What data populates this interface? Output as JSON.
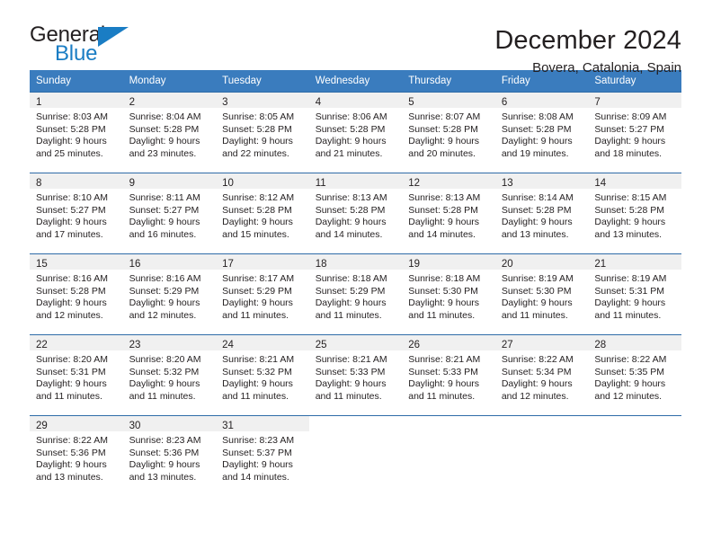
{
  "brand": {
    "name_dark": "General",
    "name_light": "Blue",
    "triangle_icon": "brand-triangle-icon",
    "accent_color": "#1a7dc4"
  },
  "header": {
    "title": "December 2024",
    "subtitle": "Bovera, Catalonia, Spain"
  },
  "colors": {
    "header_blue": "#3a7cbe",
    "row_divider_blue": "#2f6ca8",
    "daynum_band": "#f0f0f0",
    "text": "#231f20"
  },
  "weekday_headers": [
    "Sunday",
    "Monday",
    "Tuesday",
    "Wednesday",
    "Thursday",
    "Friday",
    "Saturday"
  ],
  "weeks": [
    [
      {
        "day": "1",
        "sunrise": "Sunrise: 8:03 AM",
        "sunset": "Sunset: 5:28 PM",
        "daylight1": "Daylight: 9 hours",
        "daylight2": "and 25 minutes."
      },
      {
        "day": "2",
        "sunrise": "Sunrise: 8:04 AM",
        "sunset": "Sunset: 5:28 PM",
        "daylight1": "Daylight: 9 hours",
        "daylight2": "and 23 minutes."
      },
      {
        "day": "3",
        "sunrise": "Sunrise: 8:05 AM",
        "sunset": "Sunset: 5:28 PM",
        "daylight1": "Daylight: 9 hours",
        "daylight2": "and 22 minutes."
      },
      {
        "day": "4",
        "sunrise": "Sunrise: 8:06 AM",
        "sunset": "Sunset: 5:28 PM",
        "daylight1": "Daylight: 9 hours",
        "daylight2": "and 21 minutes."
      },
      {
        "day": "5",
        "sunrise": "Sunrise: 8:07 AM",
        "sunset": "Sunset: 5:28 PM",
        "daylight1": "Daylight: 9 hours",
        "daylight2": "and 20 minutes."
      },
      {
        "day": "6",
        "sunrise": "Sunrise: 8:08 AM",
        "sunset": "Sunset: 5:28 PM",
        "daylight1": "Daylight: 9 hours",
        "daylight2": "and 19 minutes."
      },
      {
        "day": "7",
        "sunrise": "Sunrise: 8:09 AM",
        "sunset": "Sunset: 5:27 PM",
        "daylight1": "Daylight: 9 hours",
        "daylight2": "and 18 minutes."
      }
    ],
    [
      {
        "day": "8",
        "sunrise": "Sunrise: 8:10 AM",
        "sunset": "Sunset: 5:27 PM",
        "daylight1": "Daylight: 9 hours",
        "daylight2": "and 17 minutes."
      },
      {
        "day": "9",
        "sunrise": "Sunrise: 8:11 AM",
        "sunset": "Sunset: 5:27 PM",
        "daylight1": "Daylight: 9 hours",
        "daylight2": "and 16 minutes."
      },
      {
        "day": "10",
        "sunrise": "Sunrise: 8:12 AM",
        "sunset": "Sunset: 5:28 PM",
        "daylight1": "Daylight: 9 hours",
        "daylight2": "and 15 minutes."
      },
      {
        "day": "11",
        "sunrise": "Sunrise: 8:13 AM",
        "sunset": "Sunset: 5:28 PM",
        "daylight1": "Daylight: 9 hours",
        "daylight2": "and 14 minutes."
      },
      {
        "day": "12",
        "sunrise": "Sunrise: 8:13 AM",
        "sunset": "Sunset: 5:28 PM",
        "daylight1": "Daylight: 9 hours",
        "daylight2": "and 14 minutes."
      },
      {
        "day": "13",
        "sunrise": "Sunrise: 8:14 AM",
        "sunset": "Sunset: 5:28 PM",
        "daylight1": "Daylight: 9 hours",
        "daylight2": "and 13 minutes."
      },
      {
        "day": "14",
        "sunrise": "Sunrise: 8:15 AM",
        "sunset": "Sunset: 5:28 PM",
        "daylight1": "Daylight: 9 hours",
        "daylight2": "and 13 minutes."
      }
    ],
    [
      {
        "day": "15",
        "sunrise": "Sunrise: 8:16 AM",
        "sunset": "Sunset: 5:28 PM",
        "daylight1": "Daylight: 9 hours",
        "daylight2": "and 12 minutes."
      },
      {
        "day": "16",
        "sunrise": "Sunrise: 8:16 AM",
        "sunset": "Sunset: 5:29 PM",
        "daylight1": "Daylight: 9 hours",
        "daylight2": "and 12 minutes."
      },
      {
        "day": "17",
        "sunrise": "Sunrise: 8:17 AM",
        "sunset": "Sunset: 5:29 PM",
        "daylight1": "Daylight: 9 hours",
        "daylight2": "and 11 minutes."
      },
      {
        "day": "18",
        "sunrise": "Sunrise: 8:18 AM",
        "sunset": "Sunset: 5:29 PM",
        "daylight1": "Daylight: 9 hours",
        "daylight2": "and 11 minutes."
      },
      {
        "day": "19",
        "sunrise": "Sunrise: 8:18 AM",
        "sunset": "Sunset: 5:30 PM",
        "daylight1": "Daylight: 9 hours",
        "daylight2": "and 11 minutes."
      },
      {
        "day": "20",
        "sunrise": "Sunrise: 8:19 AM",
        "sunset": "Sunset: 5:30 PM",
        "daylight1": "Daylight: 9 hours",
        "daylight2": "and 11 minutes."
      },
      {
        "day": "21",
        "sunrise": "Sunrise: 8:19 AM",
        "sunset": "Sunset: 5:31 PM",
        "daylight1": "Daylight: 9 hours",
        "daylight2": "and 11 minutes."
      }
    ],
    [
      {
        "day": "22",
        "sunrise": "Sunrise: 8:20 AM",
        "sunset": "Sunset: 5:31 PM",
        "daylight1": "Daylight: 9 hours",
        "daylight2": "and 11 minutes."
      },
      {
        "day": "23",
        "sunrise": "Sunrise: 8:20 AM",
        "sunset": "Sunset: 5:32 PM",
        "daylight1": "Daylight: 9 hours",
        "daylight2": "and 11 minutes."
      },
      {
        "day": "24",
        "sunrise": "Sunrise: 8:21 AM",
        "sunset": "Sunset: 5:32 PM",
        "daylight1": "Daylight: 9 hours",
        "daylight2": "and 11 minutes."
      },
      {
        "day": "25",
        "sunrise": "Sunrise: 8:21 AM",
        "sunset": "Sunset: 5:33 PM",
        "daylight1": "Daylight: 9 hours",
        "daylight2": "and 11 minutes."
      },
      {
        "day": "26",
        "sunrise": "Sunrise: 8:21 AM",
        "sunset": "Sunset: 5:33 PM",
        "daylight1": "Daylight: 9 hours",
        "daylight2": "and 11 minutes."
      },
      {
        "day": "27",
        "sunrise": "Sunrise: 8:22 AM",
        "sunset": "Sunset: 5:34 PM",
        "daylight1": "Daylight: 9 hours",
        "daylight2": "and 12 minutes."
      },
      {
        "day": "28",
        "sunrise": "Sunrise: 8:22 AM",
        "sunset": "Sunset: 5:35 PM",
        "daylight1": "Daylight: 9 hours",
        "daylight2": "and 12 minutes."
      }
    ],
    [
      {
        "day": "29",
        "sunrise": "Sunrise: 8:22 AM",
        "sunset": "Sunset: 5:36 PM",
        "daylight1": "Daylight: 9 hours",
        "daylight2": "and 13 minutes."
      },
      {
        "day": "30",
        "sunrise": "Sunrise: 8:23 AM",
        "sunset": "Sunset: 5:36 PM",
        "daylight1": "Daylight: 9 hours",
        "daylight2": "and 13 minutes."
      },
      {
        "day": "31",
        "sunrise": "Sunrise: 8:23 AM",
        "sunset": "Sunset: 5:37 PM",
        "daylight1": "Daylight: 9 hours",
        "daylight2": "and 14 minutes."
      },
      {
        "day": "",
        "sunrise": "",
        "sunset": "",
        "daylight1": "",
        "daylight2": ""
      },
      {
        "day": "",
        "sunrise": "",
        "sunset": "",
        "daylight1": "",
        "daylight2": ""
      },
      {
        "day": "",
        "sunrise": "",
        "sunset": "",
        "daylight1": "",
        "daylight2": ""
      },
      {
        "day": "",
        "sunrise": "",
        "sunset": "",
        "daylight1": "",
        "daylight2": ""
      }
    ]
  ]
}
